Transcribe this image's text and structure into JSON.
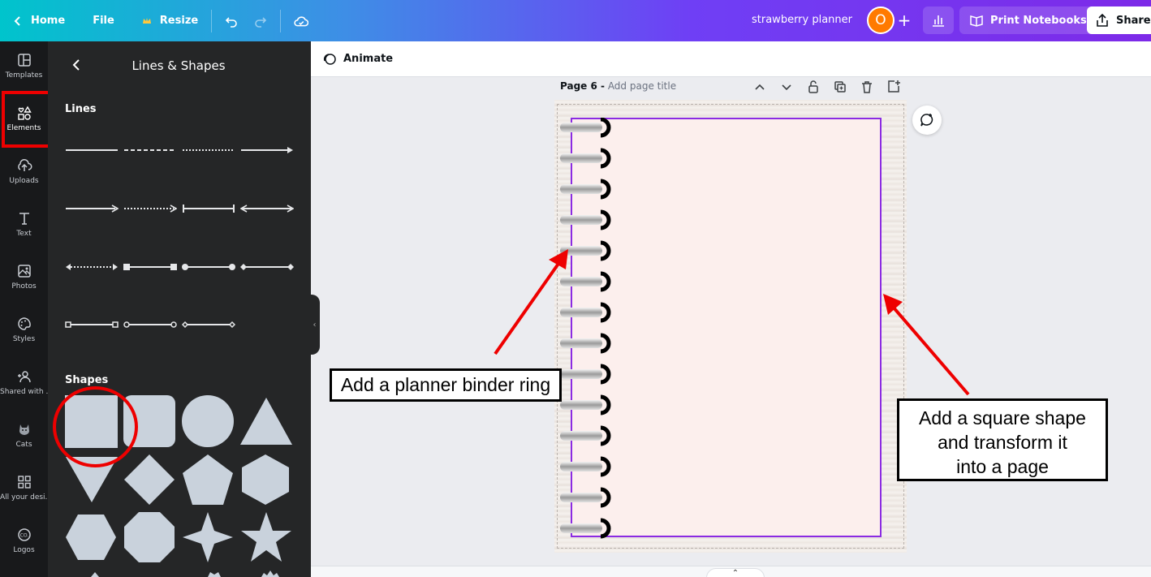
{
  "topbar": {
    "home_label": "Home",
    "file_label": "File",
    "resize_label": "Resize",
    "doc_title": "strawberry planner",
    "avatar_initial": "O",
    "print_label": "Print Notebooks",
    "share_label": "Share",
    "gradient_colors": [
      "#00c4cc",
      "#3e8ee6",
      "#6f3ff5",
      "#7d2ae8"
    ]
  },
  "rail": {
    "items": [
      {
        "label": "Templates",
        "icon": "templates-icon"
      },
      {
        "label": "Elements",
        "icon": "elements-icon"
      },
      {
        "label": "Uploads",
        "icon": "uploads-icon"
      },
      {
        "label": "Text",
        "icon": "text-icon"
      },
      {
        "label": "Photos",
        "icon": "photos-icon"
      },
      {
        "label": "Styles",
        "icon": "styles-icon"
      },
      {
        "label": "Shared with ...",
        "icon": "shared-icon"
      },
      {
        "label": "Cats",
        "icon": "cats-icon"
      },
      {
        "label": "All your desi...",
        "icon": "all-designs-icon"
      },
      {
        "label": "Logos",
        "icon": "logos-icon"
      }
    ],
    "active_item": "Elements"
  },
  "panel": {
    "title": "Lines & Shapes",
    "lines_label": "Lines",
    "shapes_label": "Shapes",
    "shape_color": "#c9d2dc"
  },
  "editor": {
    "animate_label": "Animate",
    "page_number_label": "Page 6 -",
    "page_title_placeholder": "Add page title",
    "page_color": "#fcefed",
    "selection_color": "#8b2be2"
  },
  "annotations": {
    "binder_note": "Add a planner binder ring",
    "square_note_lines": [
      "Add a square shape",
      "and transform it",
      "into a page"
    ],
    "arrow_color": "#ee0000"
  }
}
